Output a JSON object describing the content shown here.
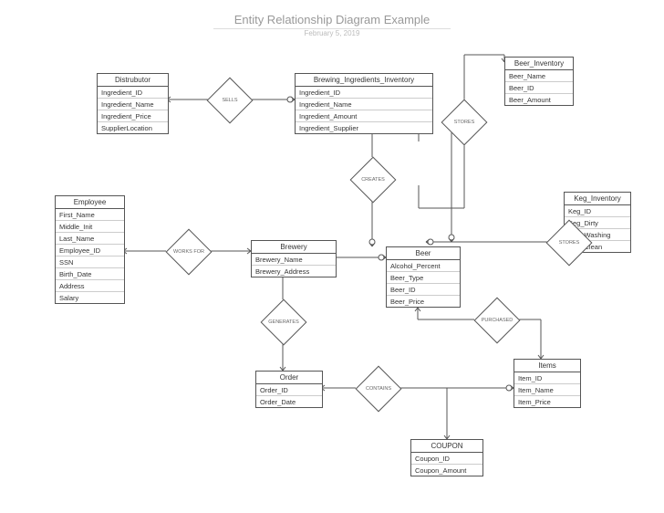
{
  "title": "Entity Relationship Diagram Example",
  "date": "February 5, 2019",
  "entities": {
    "distributor": {
      "name": "Distrubutor",
      "attrs": [
        "Ingredient_ID",
        "Ingredient_Name",
        "Ingredient_Price",
        "SupplierLocation"
      ]
    },
    "brewing_inv": {
      "name": "Brewing_Ingredients_Inventory",
      "attrs": [
        "Ingredient_ID",
        "Ingredient_Name",
        "Ingredient_Amount",
        "Ingredient_Supplier"
      ]
    },
    "beer_inv": {
      "name": "Beer_Inventory",
      "attrs": [
        "Beer_Name",
        "Beer_ID",
        "Beer_Amount"
      ]
    },
    "employee": {
      "name": "Employee",
      "attrs": [
        "First_Name",
        "Middle_Init",
        "Last_Name",
        "Employee_ID",
        "SSN",
        "Birth_Date",
        "Address",
        "Salary"
      ]
    },
    "brewery": {
      "name": "Brewery",
      "attrs": [
        "Brewery_Name",
        "Brewery_Address"
      ]
    },
    "beer": {
      "name": "Beer",
      "attrs": [
        "Alcohol_Percent",
        "Beer_Type",
        "Beer_ID",
        "Beer_Price"
      ]
    },
    "keg_inv": {
      "name": "Keg_Inventory",
      "attrs": [
        "Keg_ID",
        "Keg_Dirty",
        "Keg_Washing",
        "Keg_Clean"
      ]
    },
    "order": {
      "name": "Order",
      "attrs": [
        "Order_ID",
        "Order_Date"
      ]
    },
    "items": {
      "name": "Items",
      "attrs": [
        "Item_ID",
        "Item_Name",
        "Item_Price"
      ]
    },
    "coupon": {
      "name": "COUPON",
      "attrs": [
        "Coupon_ID",
        "Coupon_Amount"
      ]
    }
  },
  "relationships": {
    "sells": "SELLS",
    "creates": "CREATES",
    "stores1": "STORES",
    "stores2": "STORES",
    "works_for": "WORKS FOR",
    "generates": "GENERATES",
    "contains": "CONTAINS",
    "purchased": "PURCHASED"
  }
}
